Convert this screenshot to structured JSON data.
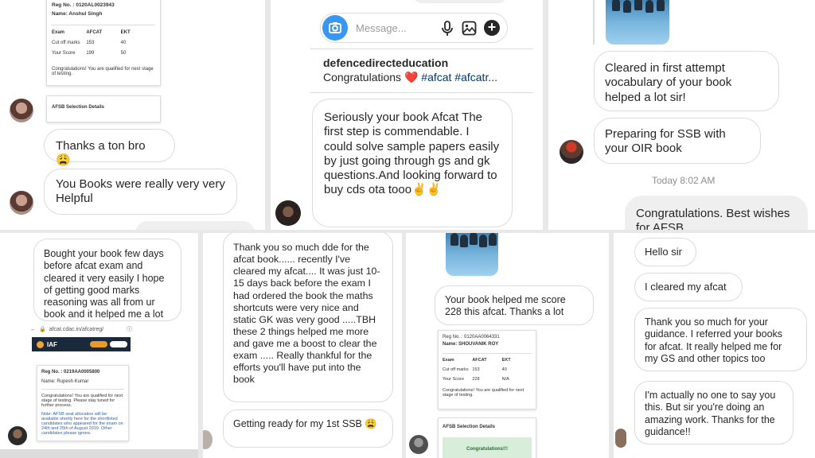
{
  "p1": {
    "card": {
      "reg": "Reg No. : 0120AL0023943",
      "name": "Name: Anshul Singh",
      "headers": [
        "Exam",
        "AFCAT",
        "EKT"
      ],
      "rows": [
        [
          "Cut off marks",
          "153",
          "40"
        ],
        [
          "Your Score",
          "199",
          "50"
        ]
      ],
      "note": "Congratulations! You are qualified for next stage of testing.",
      "afsb": "AFSB Selection Details"
    },
    "msg1": "Thanks a ton bro 😩",
    "msg2": "You Books were really very very Helpful"
  },
  "p2": {
    "placeholder": "Message...",
    "username": "defencedirecteducation",
    "caption": "Congratulations ❤️ #afcat #afcatr...",
    "msg": "Seriously your book Afcat The first step is commendable. I could solve sample papers easily by just going through gs and gk questions.And looking forward to buy cds ota tooo✌️✌️"
  },
  "p3": {
    "msg1": "Cleared in first attempt vocabulary of your book helped a lot sir!",
    "msg2": "Preparing for SSB with your OIR book",
    "time": "Today 8:02 AM",
    "sent": "Congratulations. Best wishes for AFSB"
  },
  "p4": {
    "msg": "Bought your book few days before afcat exam and cleared it very easily I hope of getting good marks reasoning was all from ur book and it helped me a lot",
    "url": "afcat.cdac.in/afcatreg/",
    "iaf": "IAF",
    "card": {
      "reg": "Reg No. : 0219AA0005800",
      "name": "Name: Rupesh Kumar",
      "note": "Congratulations! You are qualified for next stage of testing. Please stay tuned for further process.",
      "note2": "Note: AFSB seat allocation will be available shortly here for the shortlisted candidates who appeared for the exam on 24th and 25th of August 2019. Other candidates please ignore."
    }
  },
  "p5": {
    "msg1": "Thank you so much dde for the afcat book...... recently I've cleared my afcat.... It was just 10-15 days back before the exam  I had ordered the book the maths shortcuts were very nice and static GK was very good .....TBH these 2 things helped me more and gave me a boost to clear the exam ..... Really thankful for the efforts you'll have put into the book",
    "msg2": "Getting ready for my 1st SSB 😩"
  },
  "p6": {
    "msg": "Your book helped me score 228 this afcat. Thanks a lot",
    "card": {
      "reg": "Reg No. : 0120AA0064331",
      "name": "Name: SHOUVANIK ROY",
      "headers": [
        "Exam",
        "AFCAT",
        "EKT"
      ],
      "rows": [
        [
          "Cut off marks",
          "153",
          "40"
        ],
        [
          "Your Score",
          "228",
          "N/A"
        ]
      ],
      "note": "Congratulations! You are qualified for next stage of testing.",
      "afsb": "AFSB Selection Details",
      "congrats": "Congratulations!!!"
    }
  },
  "p7": {
    "msg1": "Hello sir",
    "msg2": "I cleared my afcat",
    "msg3": "Thank you so much for your guidance. I referred your books for afcat. It really helped me for my GS and other topics too",
    "msg4": "I'm actually no one to say you this. But sir you're doing an amazing work. Thanks for the guidance!!"
  },
  "colors": {
    "blue": "#3897f0",
    "heart": "#ed4956",
    "hashtag": "#00376b"
  }
}
